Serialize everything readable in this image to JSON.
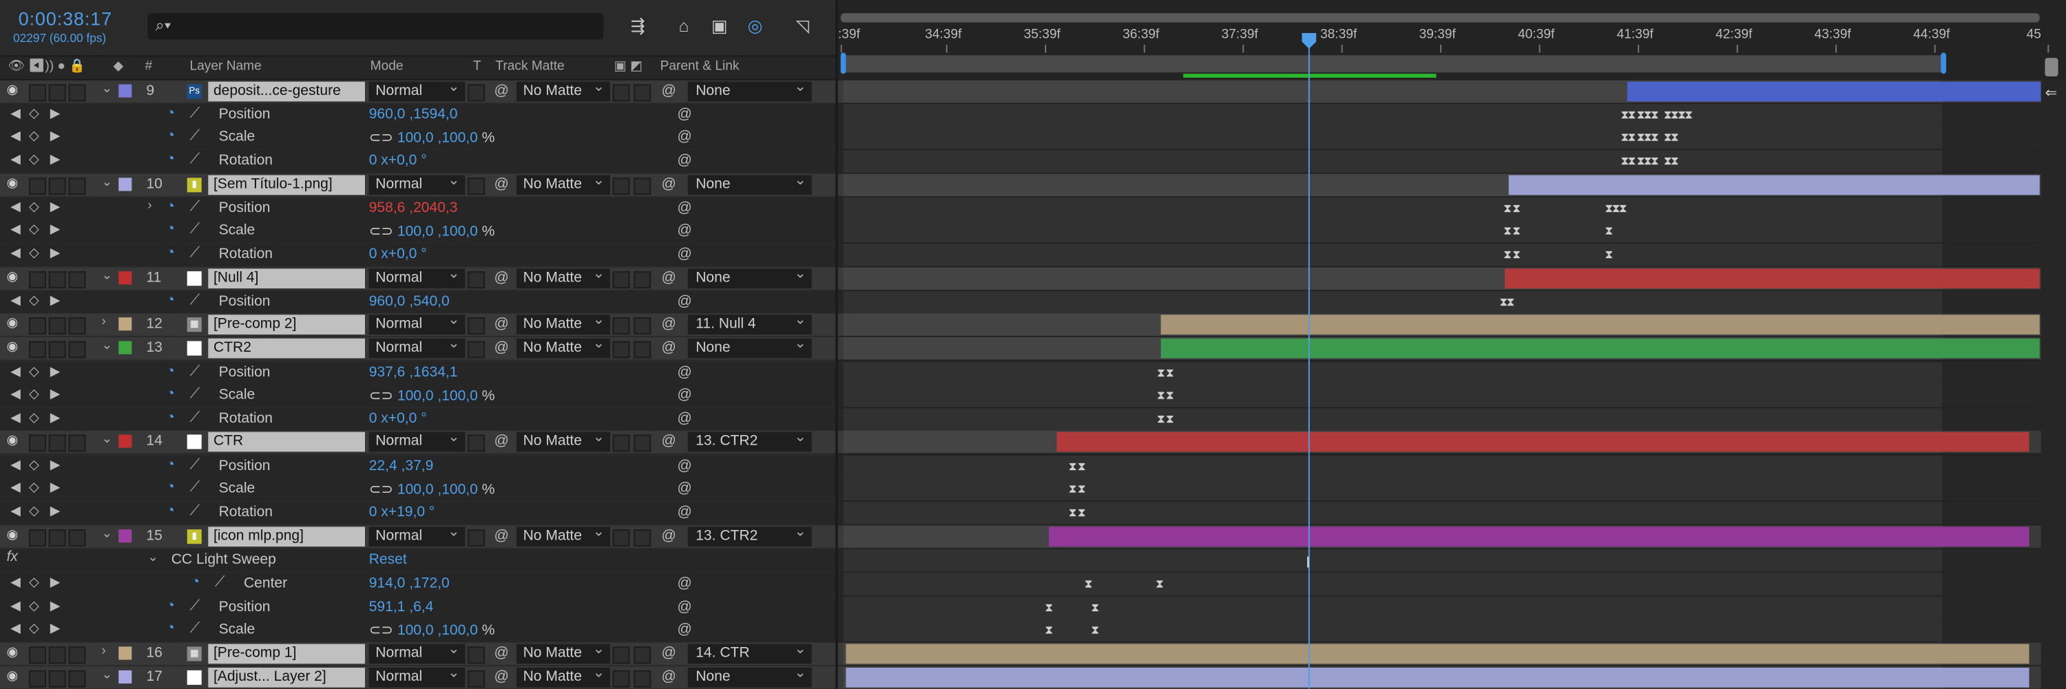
{
  "header": {
    "timecode": "0:00:38:17",
    "frame_info": "02297 (60.00 fps)",
    "search_placeholder": "⌕▾"
  },
  "columns": {
    "layer_name": "Layer Name",
    "mode": "Mode",
    "t": "T",
    "track_matte": "Track Matte",
    "parent_link": "Parent & Link",
    "number": "#"
  },
  "ruler": {
    "ticks": [
      ":39f",
      "34:39f",
      "35:39f",
      "36:39f",
      "37:39f",
      "38:39f",
      "39:39f",
      "40:39f",
      "41:39f",
      "42:39f",
      "43:39f",
      "44:39f",
      "45"
    ]
  },
  "layers": [
    {
      "num": "9",
      "name": "deposit...ce-gesture",
      "mode": "Normal",
      "matte": "No Matte",
      "parent": "None",
      "label": "#7b7bd8"
    },
    {
      "num": "10",
      "name": "[Sem Título-1.png]",
      "mode": "Normal",
      "matte": "No Matte",
      "parent": "None",
      "label": "#a8a8e0"
    },
    {
      "num": "11",
      "name": "[Null 4]",
      "mode": "Normal",
      "matte": "No Matte",
      "parent": "None",
      "label": "#c03030"
    },
    {
      "num": "12",
      "name": "[Pre-comp 2]",
      "mode": "Normal",
      "matte": "No Matte",
      "parent": "11. Null 4",
      "label": "#bfa881"
    },
    {
      "num": "13",
      "name": "CTR2",
      "mode": "Normal",
      "matte": "No Matte",
      "parent": "None",
      "label": "#3fa53f"
    },
    {
      "num": "14",
      "name": "CTR",
      "mode": "Normal",
      "matte": "No Matte",
      "parent": "13. CTR2",
      "label": "#c03030"
    },
    {
      "num": "15",
      "name": "[icon mlp.png]",
      "mode": "Normal",
      "matte": "No Matte",
      "parent": "13. CTR2",
      "label": "#9c3fa0"
    },
    {
      "num": "16",
      "name": "[Pre-comp 1]",
      "mode": "Normal",
      "matte": "No Matte",
      "parent": "14. CTR",
      "label": "#bfa881"
    },
    {
      "num": "17",
      "name": "[Adjust... Layer 2]",
      "mode": "Normal",
      "matte": "No Matte",
      "parent": "None",
      "label": "#a8a8e0"
    }
  ],
  "props": {
    "p9_pos": {
      "name": "Position",
      "value": "960,0 ,1594,0"
    },
    "p9_scale": {
      "name": "Scale",
      "value": "100,0 ,100,0",
      "unit": "%"
    },
    "p9_rot": {
      "name": "Rotation",
      "value": "0 x+0,0 °"
    },
    "p10_pos": {
      "name": "Position",
      "value": "958,6 ,2040,3"
    },
    "p10_scale": {
      "name": "Scale",
      "value": "100,0 ,100,0",
      "unit": "%"
    },
    "p10_rot": {
      "name": "Rotation",
      "value": "0 x+0,0 °"
    },
    "p11_pos": {
      "name": "Position",
      "value": "960,0 ,540,0"
    },
    "p13_pos": {
      "name": "Position",
      "value": "937,6 ,1634,1"
    },
    "p13_scale": {
      "name": "Scale",
      "value": "100,0 ,100,0",
      "unit": "%"
    },
    "p13_rot": {
      "name": "Rotation",
      "value": "0 x+0,0 °"
    },
    "p14_pos": {
      "name": "Position",
      "value": "22,4 ,37,9"
    },
    "p14_scale": {
      "name": "Scale",
      "value": "100,0 ,100,0",
      "unit": "%"
    },
    "p14_rot": {
      "name": "Rotation",
      "value": "0 x+19,0 °"
    },
    "fx_label": "fx",
    "effect_name": "CC Light Sweep",
    "effect_reset": "Reset",
    "p15_center": {
      "name": "Center",
      "value": "914,0 ,172,0"
    },
    "p15_pos": {
      "name": "Position",
      "value": "591,1 ,6,4"
    },
    "p15_scale": {
      "name": "Scale",
      "value": "100,0 ,100,0",
      "unit": "%"
    }
  },
  "colors": {
    "accent": "#4f9ee8",
    "work_area_green": "#2db52d"
  }
}
